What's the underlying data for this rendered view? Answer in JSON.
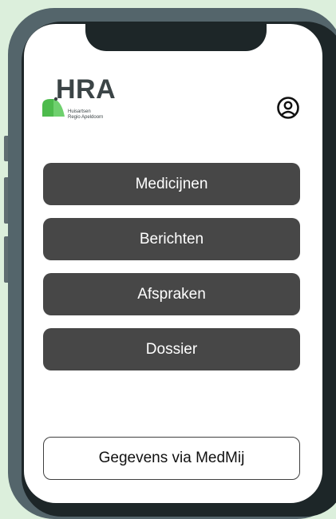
{
  "app": {
    "logo": {
      "title": "HRA",
      "subtitle_line1": "Huisartsen",
      "subtitle_line2": "Regio Apeldoorn",
      "mark_color": "#4dbb4c"
    },
    "profile_icon": "user-circle-icon"
  },
  "menu": {
    "items": [
      {
        "label": "Medicijnen"
      },
      {
        "label": "Berichten"
      },
      {
        "label": "Afspraken"
      },
      {
        "label": "Dossier"
      }
    ]
  },
  "footer": {
    "medmij_label": "Gegevens via MedMij"
  },
  "colors": {
    "background": "#dcefdc",
    "phone_frame": "#54656b",
    "button_dark": "#474747",
    "logo_green": "#4dbb4c"
  }
}
